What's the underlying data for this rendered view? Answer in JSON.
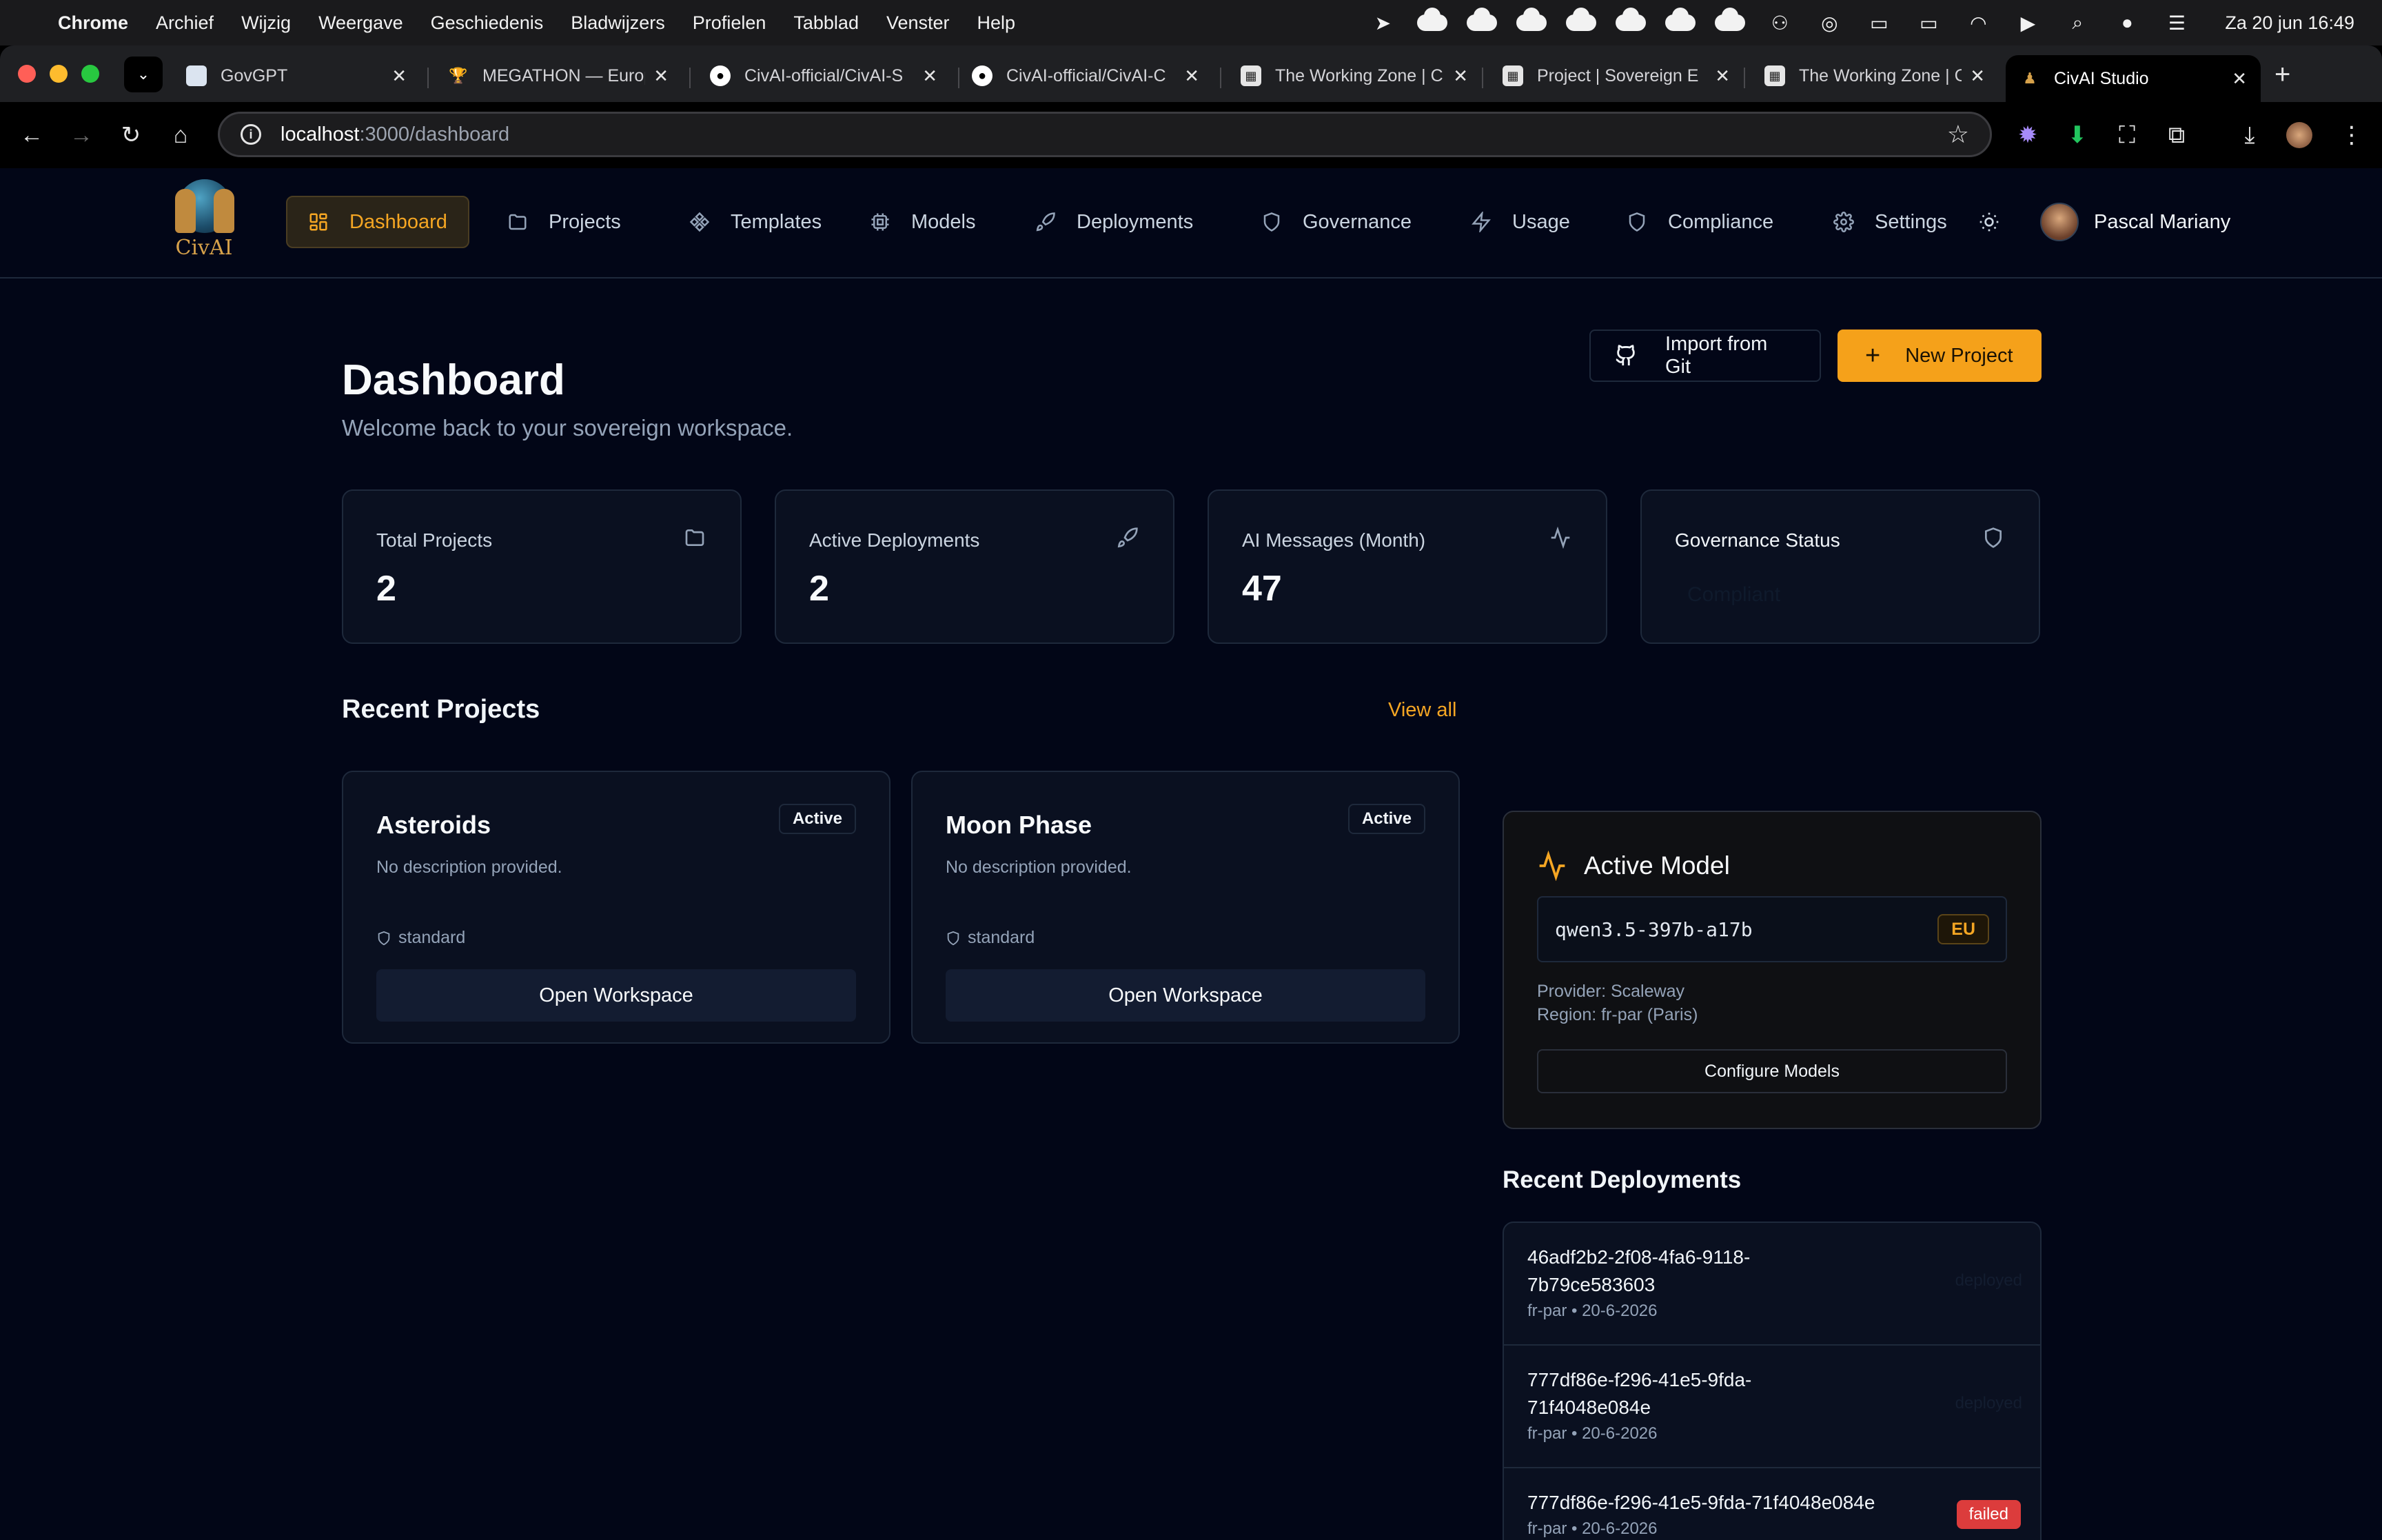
{
  "menubar": {
    "app": "Chrome",
    "items": [
      "Archief",
      "Wijzig",
      "Weergave",
      "Geschiedenis",
      "Bladwijzers",
      "Profielen",
      "Tabblad",
      "Venster",
      "Help"
    ],
    "clock": "Za 20 jun  16:49"
  },
  "tabs": [
    {
      "title": "GovGPT",
      "icon": "govgpt-favicon"
    },
    {
      "title": "MEGATHON — Europ",
      "icon": "trophy-favicon"
    },
    {
      "title": "CivAI-official/CivAI-S",
      "icon": "github-favicon"
    },
    {
      "title": "CivAI-official/CivAI-C",
      "icon": "github-favicon"
    },
    {
      "title": "The Working Zone | C",
      "icon": "workingzone-favicon"
    },
    {
      "title": "Project | Sovereign E",
      "icon": "workingzone-favicon"
    },
    {
      "title": "The Working Zone | C",
      "icon": "workingzone-favicon"
    },
    {
      "title": "CivAI Studio",
      "icon": "civai-favicon"
    }
  ],
  "address": {
    "host": "localhost",
    "path": ":3000/dashboard"
  },
  "brand": {
    "logo_text": "CivAI"
  },
  "nav": {
    "items": [
      "Dashboard",
      "Projects",
      "Templates",
      "Models",
      "Deployments",
      "Governance",
      "Usage",
      "Compliance",
      "Settings"
    ],
    "active": "Dashboard",
    "user": "Pascal Mariany"
  },
  "page": {
    "title": "Dashboard",
    "subtitle": "Welcome back to your sovereign workspace.",
    "import_label": "Import from Git",
    "new_label": "New Project"
  },
  "stats": [
    {
      "label": "Total Projects",
      "value": "2",
      "icon": "folder-icon"
    },
    {
      "label": "Active Deployments",
      "value": "2",
      "icon": "rocket-icon"
    },
    {
      "label": "AI Messages (Month)",
      "value": "47",
      "icon": "activity-icon"
    },
    {
      "label": "Governance Status",
      "value": "Compliant",
      "icon": "shield-icon"
    }
  ],
  "recent_projects": {
    "title": "Recent Projects",
    "view_all": "View all",
    "items": [
      {
        "name": "Asteroids",
        "status": "Active",
        "description": "No description provided.",
        "tier": "standard",
        "action": "Open Workspace"
      },
      {
        "name": "Moon Phase",
        "status": "Active",
        "description": "No description provided.",
        "tier": "standard",
        "action": "Open Workspace"
      }
    ]
  },
  "active_model": {
    "title": "Active Model",
    "model": "qwen3.5-397b-a17b",
    "region_badge": "EU",
    "provider": "Provider: Scaleway",
    "region": "Region: fr-par (Paris)",
    "configure": "Configure Models"
  },
  "recent_deployments": {
    "title": "Recent Deployments",
    "items": [
      {
        "id_line1": "46adf2b2-2f08-4fa6-9118-",
        "id_line2": "7b79ce583603",
        "meta": "fr-par • 20-6-2026",
        "status": "deployed"
      },
      {
        "id_line1": "777df86e-f296-41e5-9fda-",
        "id_line2": "71f4048e084e",
        "meta": "fr-par • 20-6-2026",
        "status": "deployed"
      },
      {
        "id_line1": "777df86e-f296-41e5-9fda-71f4048e084e",
        "id_line2": "",
        "meta": "fr-par • 20-6-2026",
        "status": "failed"
      }
    ]
  },
  "colors": {
    "accent": "#f5a11a",
    "background": "#020617",
    "card": "#0a1020",
    "border": "#1e293b",
    "danger": "#dc3c3c"
  }
}
